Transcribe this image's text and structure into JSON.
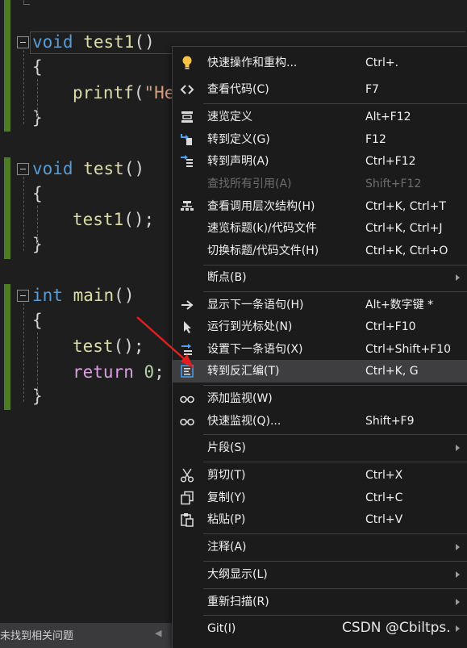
{
  "editor": {
    "lines": {
      "l1": {
        "kw": "void",
        "fn": "test1",
        "p": "()"
      },
      "l2": {
        "b": "{"
      },
      "l3": {
        "fn": "printf",
        "p": "(",
        "s": "\"He"
      },
      "l4": {
        "b": "}"
      },
      "l5": {
        "kw": "void",
        "fn": "test",
        "p": "()"
      },
      "l6": {
        "b": "{"
      },
      "l7": {
        "fn": "test1",
        "p": "();"
      },
      "l8": {
        "b": "}"
      },
      "l9": {
        "kw": "int",
        "fn": "main",
        "p": "()"
      },
      "l10": {
        "b": "{"
      },
      "l11": {
        "fn": "test",
        "p": "();"
      },
      "l12": {
        "kw": "return",
        "n": "0",
        "p": ";"
      },
      "l13": {
        "b": "}"
      }
    }
  },
  "status_bar": {
    "text": "未找到相关问题"
  },
  "menu": {
    "items": [
      {
        "label": "快速操作和重构...",
        "shortcut": "Ctrl+.",
        "icon": "lightbulb-icon"
      },
      {
        "label": "查看代码(C)",
        "shortcut": "F7",
        "icon": "code-brackets-icon"
      },
      {
        "label": "速览定义",
        "shortcut": "Alt+F12",
        "icon": "peek-definition-icon"
      },
      {
        "label": "转到定义(G)",
        "shortcut": "F12",
        "icon": "go-to-definition-icon"
      },
      {
        "label": "转到声明(A)",
        "shortcut": "Ctrl+F12",
        "icon": "go-to-declaration-icon"
      },
      {
        "label": "查找所有引用(A)",
        "shortcut": "Shift+F12",
        "icon": "",
        "disabled": true
      },
      {
        "label": "查看调用层次结构(H)",
        "shortcut": "Ctrl+K, Ctrl+T",
        "icon": "call-hierarchy-icon"
      },
      {
        "label": "速览标题(k)/代码文件",
        "shortcut": "Ctrl+K, Ctrl+J",
        "icon": ""
      },
      {
        "label": "切换标题/代码文件(H)",
        "shortcut": "Ctrl+K, Ctrl+O",
        "icon": ""
      },
      {
        "label": "断点(B)",
        "shortcut": "",
        "icon": "",
        "submenu": true
      },
      {
        "label": "显示下一条语句(H)",
        "shortcut": "Alt+数字键 *",
        "icon": "right-arrow-icon"
      },
      {
        "label": "运行到光标处(N)",
        "shortcut": "Ctrl+F10",
        "icon": "cursor-icon"
      },
      {
        "label": "设置下一条语句(X)",
        "shortcut": "Ctrl+Shift+F10",
        "icon": "set-next-statement-icon"
      },
      {
        "label": "转到反汇编(T)",
        "shortcut": "Ctrl+K, G",
        "icon": "disassembly-icon",
        "highlighted": true
      },
      {
        "label": "添加监视(W)",
        "shortcut": "",
        "icon": "glasses-icon"
      },
      {
        "label": "快速监视(Q)...",
        "shortcut": "Shift+F9",
        "icon": "glasses-icon"
      },
      {
        "label": "片段(S)",
        "shortcut": "",
        "icon": "",
        "submenu": true
      },
      {
        "label": "剪切(T)",
        "shortcut": "Ctrl+X",
        "icon": "scissors-icon"
      },
      {
        "label": "复制(Y)",
        "shortcut": "Ctrl+C",
        "icon": "copy-icon"
      },
      {
        "label": "粘贴(P)",
        "shortcut": "Ctrl+V",
        "icon": "paste-icon"
      },
      {
        "label": "注释(A)",
        "shortcut": "",
        "icon": "",
        "submenu": true
      },
      {
        "label": "大纲显示(L)",
        "shortcut": "",
        "icon": "",
        "submenu": true
      },
      {
        "label": "重新扫描(R)",
        "shortcut": "",
        "icon": "",
        "submenu": true
      },
      {
        "label": "Git(I)",
        "shortcut": "",
        "icon": "",
        "submenu": true
      }
    ]
  },
  "watermark": "CSDN @Cbiltps.",
  "colors": {
    "keyword": "#569cd6",
    "function": "#dcdcaa",
    "string": "#d69d85",
    "number": "#b5cea8",
    "control_keyword": "#d8a0df",
    "annotation_arrow": "#e02020",
    "change_bar": "#4e7b2a"
  }
}
